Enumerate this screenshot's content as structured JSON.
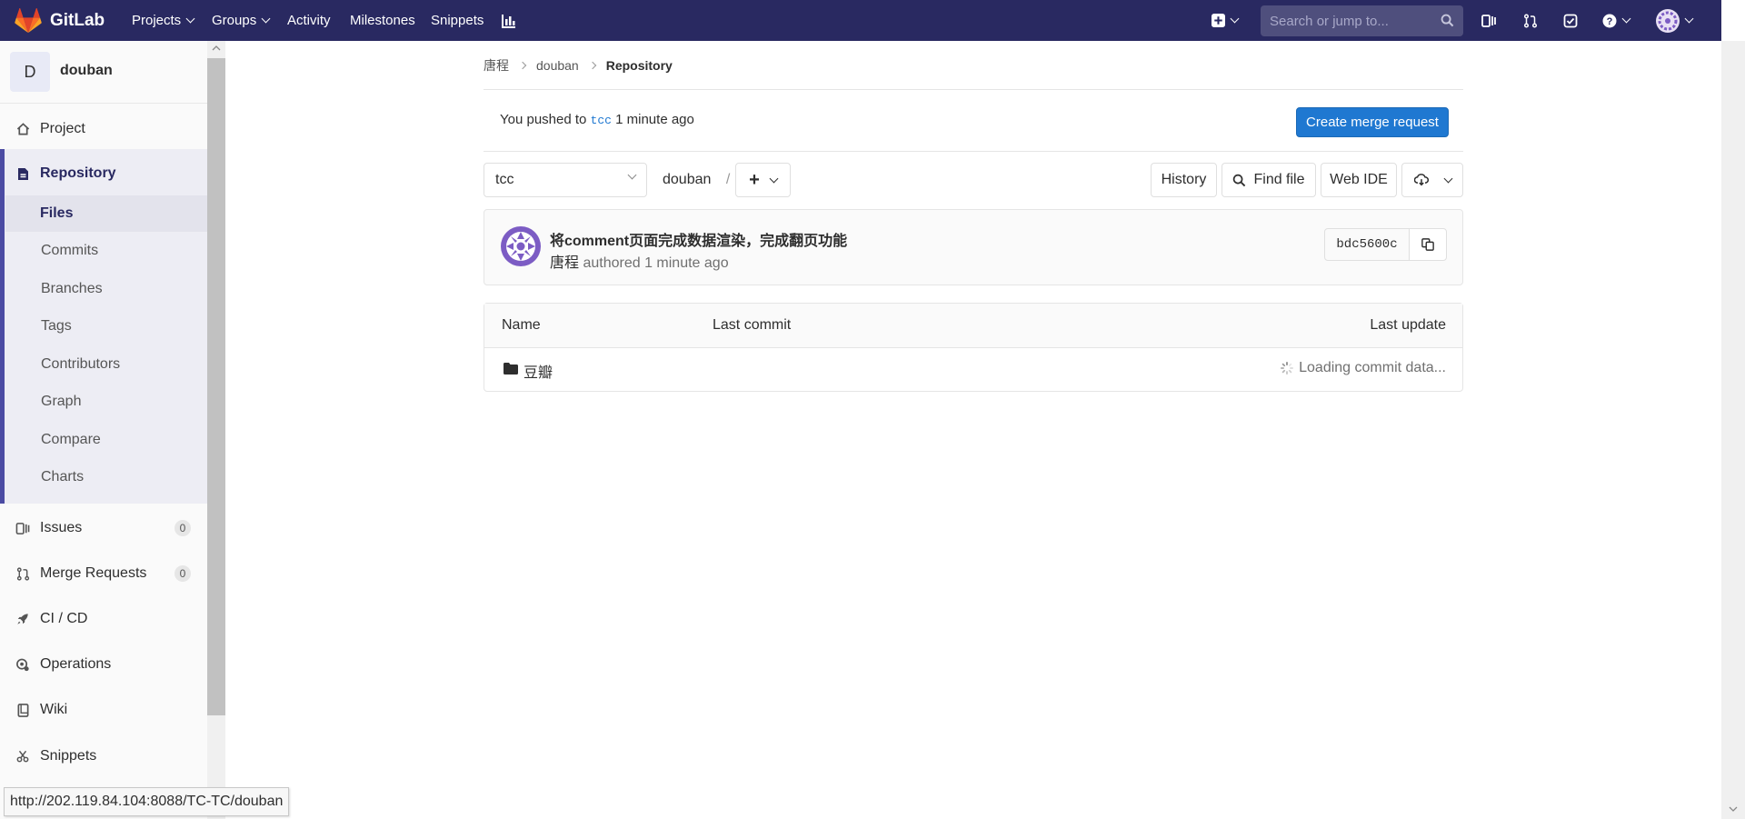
{
  "navbar": {
    "logo_text": "GitLab",
    "menu": [
      "Projects",
      "Groups",
      "Activity",
      "Milestones",
      "Snippets"
    ],
    "search_placeholder": "Search or jump to...",
    "bg_color": "#292961"
  },
  "sidebar": {
    "project_initial": "D",
    "project_name": "douban",
    "items": [
      {
        "label": "Project",
        "icon": "home-icon"
      },
      {
        "label": "Repository",
        "icon": "doc-icon"
      },
      {
        "label": "Issues",
        "icon": "issues-icon",
        "count": "0"
      },
      {
        "label": "Merge Requests",
        "icon": "merge-request-icon",
        "count": "0"
      },
      {
        "label": "CI / CD",
        "icon": "rocket-icon"
      },
      {
        "label": "Operations",
        "icon": "operations-icon"
      },
      {
        "label": "Wiki",
        "icon": "book-icon"
      },
      {
        "label": "Snippets",
        "icon": "scissors-icon"
      }
    ],
    "repo_sub": [
      "Files",
      "Commits",
      "Branches",
      "Tags",
      "Contributors",
      "Graph",
      "Compare",
      "Charts"
    ],
    "active_sub": "Files"
  },
  "breadcrumb": [
    "唐程",
    "douban",
    "Repository"
  ],
  "push_banner": {
    "prefix": "You pushed to",
    "branch": "tcc",
    "suffix": "1 minute ago",
    "button": "Create merge request"
  },
  "toolbar": {
    "branch": "tcc",
    "path": "douban",
    "path_sep": "/",
    "add_icon": "+",
    "history": "History",
    "find_file": "Find file",
    "web_ide": "Web IDE"
  },
  "commit": {
    "title": "将comment页面完成数据渲染，完成翻页功能",
    "author": "唐程",
    "meta": "authored 1 minute ago",
    "sha": "bdc5600c"
  },
  "table": {
    "headers": {
      "name": "Name",
      "last_commit": "Last commit",
      "last_update": "Last update"
    },
    "rows": [
      {
        "name": "豆瓣",
        "status": "Loading commit data..."
      }
    ]
  },
  "status_bar": {
    "url": "http://202.119.84.104:8088/TC-TC/douban"
  },
  "colors": {
    "primary": "#1f78d1",
    "accent": "#4b4ba3"
  }
}
